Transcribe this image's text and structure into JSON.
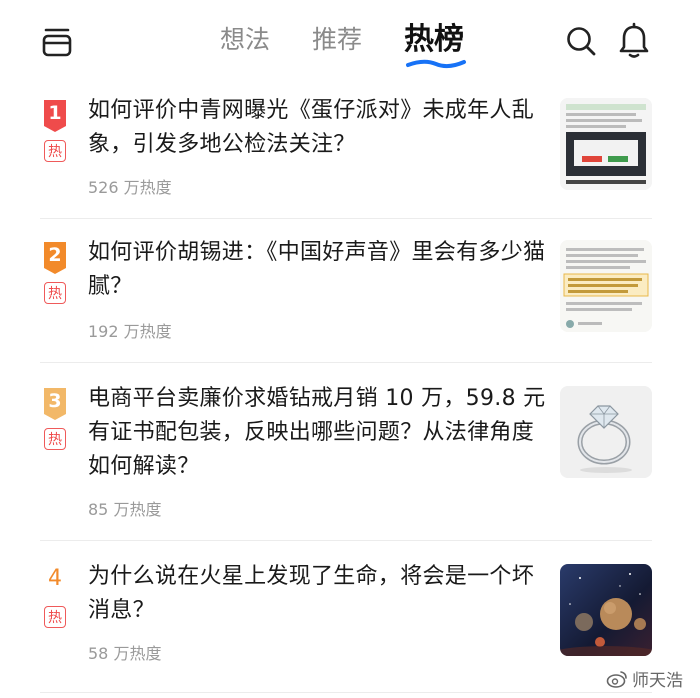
{
  "header": {
    "tabs": [
      {
        "label": "想法",
        "active": false
      },
      {
        "label": "推荐",
        "active": false
      },
      {
        "label": "热榜",
        "active": true
      }
    ],
    "icons": {
      "menu": "menu-icon",
      "search": "search-icon",
      "bell": "bell-icon"
    },
    "accent_color": "#1772f6"
  },
  "hot_list": [
    {
      "rank": "1",
      "hot_tag": "热",
      "title": "如何评价中青网曝光《蛋仔派对》未成年人乱象，引发多地公检法关注？",
      "heat": "526 万热度",
      "thumb": "screenshot-news"
    },
    {
      "rank": "2",
      "hot_tag": "热",
      "title": "如何评价胡锡进：《中国好声音》里会有多少猫腻？",
      "heat": "192 万热度",
      "thumb": "screenshot-article"
    },
    {
      "rank": "3",
      "hot_tag": "热",
      "title": "电商平台卖廉价求婚钻戒月销 10 万，59.8 元有证书配包装，反映出哪些问题？从法律角度如何解读？",
      "heat": "85 万热度",
      "thumb": "diamond-ring"
    },
    {
      "rank": "4",
      "hot_tag": "热",
      "title": "为什么说在火星上发现了生命，将会是一个坏消息？",
      "heat": "58 万热度",
      "thumb": "planets-space"
    }
  ],
  "watermark": {
    "text": "师天浩",
    "icon": "weibo-icon"
  },
  "colors": {
    "rank1": "#ef4b4b",
    "rank2": "#f28a2a",
    "rank3": "#f2b868",
    "hot_tag": "#ef4b4b",
    "heat_text": "#9a9a9a"
  }
}
